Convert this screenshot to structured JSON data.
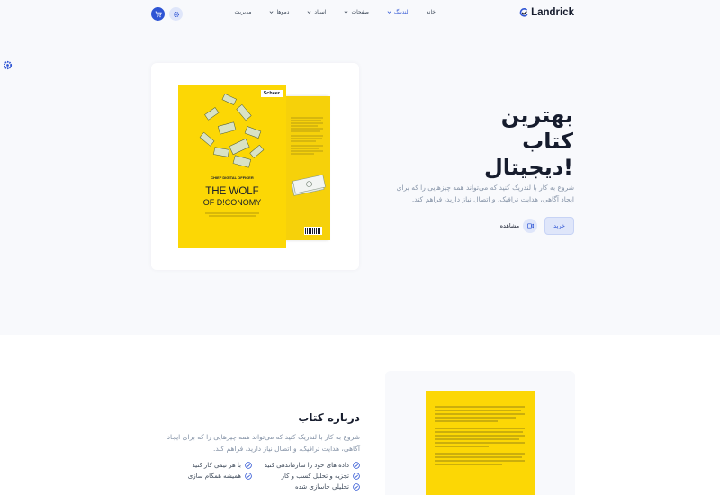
{
  "navbar": {
    "brand": "Landrick",
    "links": [
      {
        "label": "خانه",
        "has_dropdown": false,
        "active": false
      },
      {
        "label": "لندینگ",
        "has_dropdown": true,
        "active": true
      },
      {
        "label": "صفحات",
        "has_dropdown": true,
        "active": false
      },
      {
        "label": "اسناد",
        "has_dropdown": true,
        "active": false
      },
      {
        "label": "دموها",
        "has_dropdown": true,
        "active": false
      },
      {
        "label": "مدیریت",
        "has_dropdown": false,
        "active": false
      }
    ],
    "icons": {
      "cart": "cart-icon",
      "settings": "gear-icon"
    }
  },
  "hero": {
    "title_line1": "بهترین",
    "title_line2": "کتاب",
    "title_line3": "دیجیتال!",
    "description": "شروع به کار با لندریک کنید که می‌تواند همه چیزهایی را که برای ایجاد آگاهی، هدایت ترافیک، و اتصال نیاز دارید، فراهم کند.",
    "buy_label": "خرید",
    "watch_label": "مشاهده",
    "book": {
      "publisher": "Scheer",
      "role": "CHIEF DIGITAL OFFICER",
      "title_line1": "THE WOLF",
      "title_line2": "OF D!CONOMY"
    }
  },
  "about": {
    "title": "درباره کتاب",
    "description": "شروع به کار با لندریک کنید که می‌تواند همه چیزهایی را که برای ایجاد آگاهی، هدایت ترافیک، و اتصال نیاز دارید، فراهم کند.",
    "features": [
      "داده های خود را سازماندهی کنید",
      "با هر تیمی کار کنید",
      "تجزیه و تحلیل کسب و کار",
      "همیشه همگام سازی",
      "تحلیلی جاسازی شده"
    ]
  },
  "colors": {
    "primary": "#2f55d4",
    "book_yellow": "#fcd705",
    "muted": "#8492a6",
    "dark": "#161c2d"
  }
}
